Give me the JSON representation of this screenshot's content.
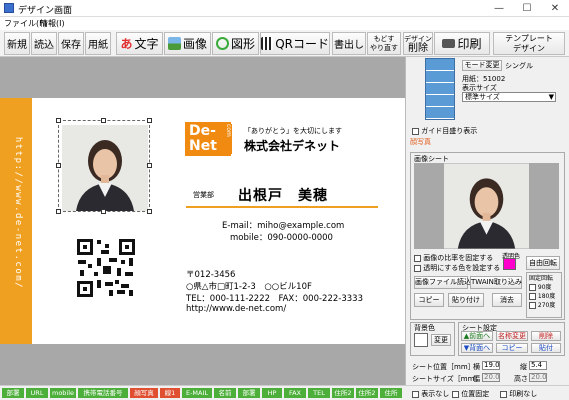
{
  "window": {
    "title": "デザイン画面",
    "min": "—",
    "max": "☐",
    "close": "✕"
  },
  "menu": [
    "ファイル(F)",
    "情報(I)"
  ],
  "toolbar": {
    "new": "新規",
    "load": "読込",
    "save": "保存",
    "paper": "用紙",
    "text": "文字",
    "image": "画像",
    "shape": "図形",
    "qr": "QRコード",
    "write": "書出し",
    "undo": "もどす",
    "redo": "やり直す",
    "design_delete_top": "デザイン",
    "design_delete_bottom": "削除",
    "print": "印刷",
    "template_top": "テンプレート",
    "template_bottom": "デザイン"
  },
  "card": {
    "tagline": "「ありがとう」を大切にします",
    "company": "株式会社デネット",
    "logo_line1": "De-",
    "logo_line2": "Net",
    "logo_side": "com",
    "dept": "営業部",
    "name": "出根戸　美穂",
    "email": "E-mail：miho@example.com",
    "mobile": "mobile：090-0000-0000",
    "zip": "〒012-3456",
    "address": "○県△市□町1-2-3　○○ビル10F",
    "telfax": "TEL：000-111-2222　FAX：000-222-3333",
    "url": "http://www.de-net.com/",
    "strip_text": "http://www.de-net.com/"
  },
  "panel": {
    "mode_change": "モード変更",
    "single": "シングル",
    "paper_label": "用紙：51002",
    "display_size_label": "表示サイズ",
    "display_size_value": "標準サイズ",
    "guide_print": "ガイド目盛り表示",
    "face_photo": "顔写真",
    "image_sheet": "画像シート",
    "keep_ratio": "画像の比率を固定する",
    "set_transparent": "透明にする色を設定する",
    "transparent_color_label": "透明色",
    "free_rotate": "自由回転",
    "read_file": "画像ファイル読込",
    "twain": "TWAIN取り込み",
    "copy": "コピー",
    "paste": "貼り付け",
    "delete": "消去",
    "fixed_rotate": "固定回転",
    "rot90": "90度",
    "rot180": "180度",
    "rot270": "270度",
    "bg_color": "背景色",
    "change": "変更",
    "sheet_setting": "シート設定",
    "front": "▲前面へ",
    "back": "▼背面へ",
    "rename": "名称変更",
    "delete2": "削除",
    "copy2": "コピー",
    "paste2": "貼付",
    "sheet_pos": "シート位置［mm］",
    "sheet_size": "シートサイズ［mm］",
    "x_label": "横",
    "x_val": "19.0",
    "y_label": "縦",
    "y_val": "5.4",
    "w_label": "幅",
    "w_val": "20.0",
    "h_label": "高さ",
    "h_val": "20.0",
    "hide": "表示なし",
    "pos_fixed": "位置固定",
    "no_print": "印刷なし"
  },
  "tags": [
    {
      "label": "部署",
      "color": "#4caf3a"
    },
    {
      "label": "URL",
      "color": "#4caf3a"
    },
    {
      "label": "mobile",
      "color": "#4caf3a"
    },
    {
      "label": "携帯電話番号",
      "color": "#4caf3a"
    },
    {
      "label": "顔写真",
      "color": "#e05030"
    },
    {
      "label": "線1",
      "color": "#e05030"
    },
    {
      "label": "E-MAIL",
      "color": "#4caf3a"
    },
    {
      "label": "名前",
      "color": "#4caf3a"
    },
    {
      "label": "部署",
      "color": "#4caf3a"
    },
    {
      "label": "HP",
      "color": "#4caf3a"
    },
    {
      "label": "FAX",
      "color": "#4caf3a"
    },
    {
      "label": "TEL",
      "color": "#4caf3a"
    },
    {
      "label": "住所2",
      "color": "#4caf3a"
    },
    {
      "label": "住所2",
      "color": "#4caf3a"
    },
    {
      "label": "住所",
      "color": "#4caf3a"
    }
  ],
  "colors": {
    "accent": "#f0a020",
    "transparent": "#ff00cc",
    "grid": "#5b9bd5"
  }
}
